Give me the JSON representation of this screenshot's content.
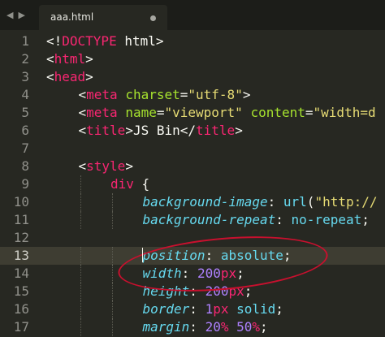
{
  "tab": {
    "title": "aaa.html",
    "dirty": true
  },
  "highlighted_line": 13,
  "lines": [
    {
      "n": "1",
      "indent": 0,
      "tokens": [
        [
          "t-plain",
          "<!"
        ],
        [
          "t-tag",
          "DOCTYPE"
        ],
        [
          "t-plain",
          " html>"
        ]
      ]
    },
    {
      "n": "2",
      "indent": 0,
      "tokens": [
        [
          "t-plain",
          "<"
        ],
        [
          "t-tag",
          "html"
        ],
        [
          "t-plain",
          ">"
        ]
      ]
    },
    {
      "n": "3",
      "indent": 0,
      "tokens": [
        [
          "t-plain",
          "<"
        ],
        [
          "t-tag",
          "head"
        ],
        [
          "t-plain",
          ">"
        ]
      ]
    },
    {
      "n": "4",
      "indent": 1,
      "tokens": [
        [
          "t-plain",
          "<"
        ],
        [
          "t-tag",
          "meta"
        ],
        [
          "t-plain",
          " "
        ],
        [
          "t-attr",
          "charset"
        ],
        [
          "t-plain",
          "="
        ],
        [
          "t-str",
          "\"utf-8\""
        ],
        [
          "t-plain",
          ">"
        ]
      ]
    },
    {
      "n": "5",
      "indent": 1,
      "tokens": [
        [
          "t-plain",
          "<"
        ],
        [
          "t-tag",
          "meta"
        ],
        [
          "t-plain",
          " "
        ],
        [
          "t-attr",
          "name"
        ],
        [
          "t-plain",
          "="
        ],
        [
          "t-str",
          "\"viewport\""
        ],
        [
          "t-plain",
          " "
        ],
        [
          "t-attr",
          "content"
        ],
        [
          "t-plain",
          "="
        ],
        [
          "t-str",
          "\"width=d"
        ]
      ]
    },
    {
      "n": "6",
      "indent": 1,
      "tokens": [
        [
          "t-plain",
          "<"
        ],
        [
          "t-tag",
          "title"
        ],
        [
          "t-plain",
          ">JS Bin</"
        ],
        [
          "t-tag",
          "title"
        ],
        [
          "t-plain",
          ">"
        ]
      ]
    },
    {
      "n": "7",
      "indent": 0,
      "tokens": []
    },
    {
      "n": "8",
      "indent": 1,
      "tokens": [
        [
          "t-plain",
          "<"
        ],
        [
          "t-tag",
          "style"
        ],
        [
          "t-plain",
          ">"
        ]
      ]
    },
    {
      "n": "9",
      "indent": 2,
      "tokens": [
        [
          "t-tag",
          "div"
        ],
        [
          "t-plain",
          " {"
        ]
      ]
    },
    {
      "n": "10",
      "indent": 3,
      "tokens": [
        [
          "t-prop",
          "background-image"
        ],
        [
          "t-plain",
          ": "
        ],
        [
          "t-fn",
          "url"
        ],
        [
          "t-plain",
          "("
        ],
        [
          "t-str",
          "\"http://"
        ]
      ]
    },
    {
      "n": "11",
      "indent": 3,
      "tokens": [
        [
          "t-prop",
          "background-repeat"
        ],
        [
          "t-plain",
          ": "
        ],
        [
          "t-fn",
          "no-repeat"
        ],
        [
          "t-plain",
          ";"
        ]
      ]
    },
    {
      "n": "12",
      "indent": 0,
      "tokens": []
    },
    {
      "n": "13",
      "indent": 3,
      "tokens": [
        [
          "t-prop",
          "position"
        ],
        [
          "t-plain",
          ": "
        ],
        [
          "t-fn",
          "absolute"
        ],
        [
          "t-plain",
          ";"
        ]
      ]
    },
    {
      "n": "14",
      "indent": 3,
      "tokens": [
        [
          "t-prop",
          "width"
        ],
        [
          "t-plain",
          ": "
        ],
        [
          "t-num",
          "200"
        ],
        [
          "t-tag",
          "px"
        ],
        [
          "t-plain",
          ";"
        ]
      ]
    },
    {
      "n": "15",
      "indent": 3,
      "tokens": [
        [
          "t-prop",
          "height"
        ],
        [
          "t-plain",
          ": "
        ],
        [
          "t-num",
          "200"
        ],
        [
          "t-tag",
          "px"
        ],
        [
          "t-plain",
          ";"
        ]
      ]
    },
    {
      "n": "16",
      "indent": 3,
      "tokens": [
        [
          "t-prop",
          "border"
        ],
        [
          "t-plain",
          ": "
        ],
        [
          "t-num",
          "1"
        ],
        [
          "t-tag",
          "px"
        ],
        [
          "t-plain",
          " "
        ],
        [
          "t-fn",
          "solid"
        ],
        [
          "t-plain",
          ";"
        ]
      ]
    },
    {
      "n": "17",
      "indent": 3,
      "tokens": [
        [
          "t-prop",
          "margin"
        ],
        [
          "t-plain",
          ": "
        ],
        [
          "t-num",
          "20"
        ],
        [
          "t-tag",
          "%"
        ],
        [
          "t-plain",
          " "
        ],
        [
          "t-num",
          "50"
        ],
        [
          "t-tag",
          "%"
        ],
        [
          "t-plain",
          ";"
        ]
      ]
    }
  ],
  "colors": {
    "background": "#272822",
    "tag": "#f92672",
    "attribute": "#a6e22e",
    "string": "#e6db74",
    "property": "#66d9ef",
    "number": "#ae81ff",
    "annotation": "#c8102e"
  }
}
